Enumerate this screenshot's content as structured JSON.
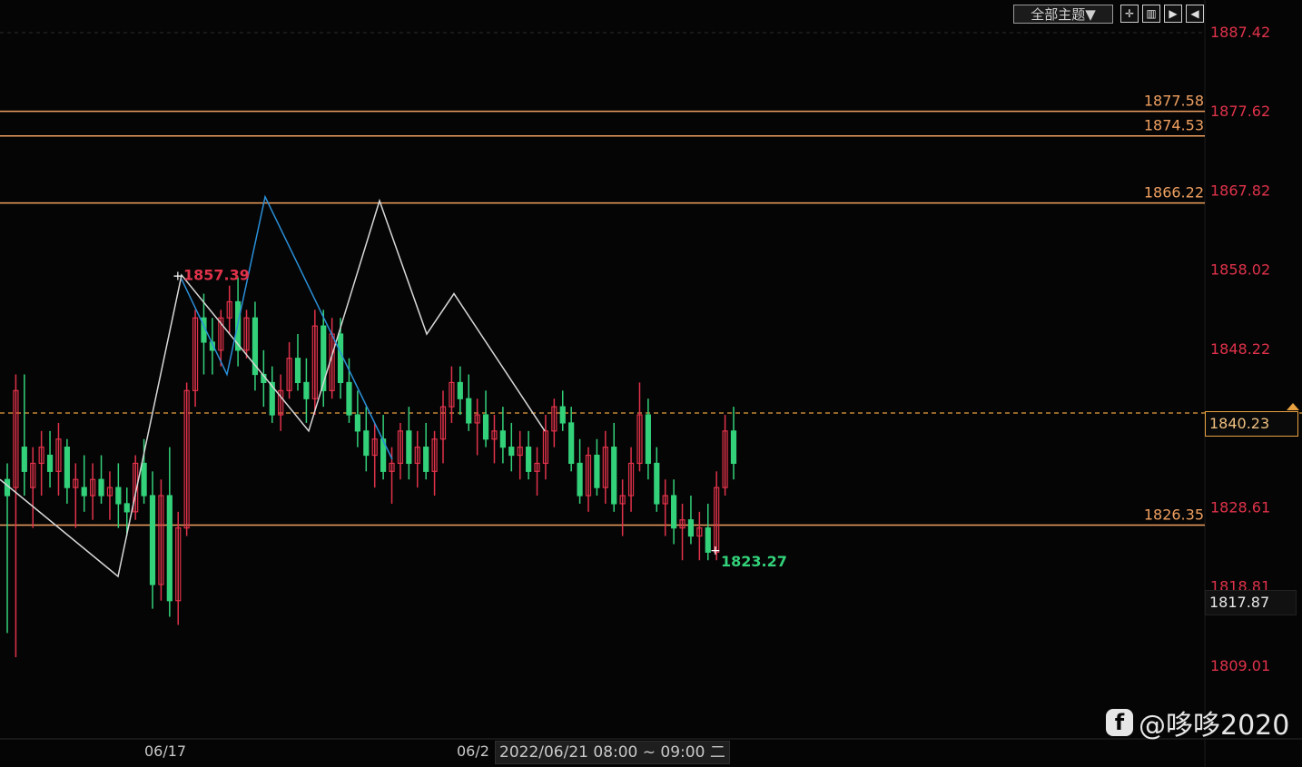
{
  "toolbar": {
    "theme_label": "全部主题▼",
    "icons": [
      "crosshair-icon",
      "bar-chart-icon",
      "play-icon",
      "back-icon"
    ]
  },
  "colors": {
    "background": "#050505",
    "up": "#e0324a",
    "down": "#33d17a",
    "level_line": "#f0a060",
    "current_line": "#e8a040",
    "zigzag_white": "#d8d8d8",
    "zigzag_blue": "#2a8fd8"
  },
  "chart_data": {
    "type": "candlestick",
    "y_axis_ticks": [
      "1887.42",
      "1877.62",
      "1867.82",
      "1858.02",
      "1848.22",
      "1828.61",
      "1818.81",
      "1809.01"
    ],
    "horizontal_levels": [
      "1877.58",
      "1874.53",
      "1866.22",
      "1826.35"
    ],
    "current_price": "1840.23",
    "hover_price": "1817.87",
    "annotations": {
      "high": "1857.39",
      "low": "1823.27"
    },
    "x_axis_dates": [
      "06/17",
      "06/2"
    ],
    "time_tooltip": "2022/06/21 08:00 ~ 09:00 二",
    "ylim": [
      1800,
      1890
    ],
    "candles": [
      [
        1832,
        1834,
        1813,
        1830
      ],
      [
        1831,
        1845,
        1810,
        1843
      ],
      [
        1836,
        1845,
        1830,
        1833
      ],
      [
        1831,
        1836,
        1826,
        1834
      ],
      [
        1834,
        1838,
        1830,
        1836
      ],
      [
        1835,
        1838,
        1831,
        1833
      ],
      [
        1833,
        1839,
        1830,
        1837
      ],
      [
        1836,
        1837,
        1829,
        1831
      ],
      [
        1831,
        1834,
        1826,
        1832
      ],
      [
        1831,
        1835,
        1828,
        1830
      ],
      [
        1830,
        1834,
        1827,
        1832
      ],
      [
        1832,
        1835,
        1829,
        1830
      ],
      [
        1830,
        1833,
        1827,
        1831
      ],
      [
        1831,
        1834,
        1826,
        1829
      ],
      [
        1829,
        1831,
        1825,
        1828
      ],
      [
        1828,
        1835,
        1827,
        1834
      ],
      [
        1834,
        1837,
        1829,
        1830
      ],
      [
        1830,
        1833,
        1816,
        1819
      ],
      [
        1819,
        1832,
        1817,
        1830
      ],
      [
        1830,
        1836,
        1815,
        1817
      ],
      [
        1817,
        1828,
        1814,
        1826
      ],
      [
        1826,
        1844,
        1825,
        1843
      ],
      [
        1843,
        1853,
        1841,
        1852
      ],
      [
        1852,
        1855,
        1845,
        1849
      ],
      [
        1849,
        1852,
        1845,
        1848
      ],
      [
        1848,
        1853,
        1846,
        1852
      ],
      [
        1852,
        1856,
        1850,
        1854
      ],
      [
        1854,
        1857,
        1846,
        1848
      ],
      [
        1848,
        1853,
        1847,
        1852
      ],
      [
        1852,
        1854,
        1843,
        1845
      ],
      [
        1845,
        1848,
        1841,
        1844
      ],
      [
        1844,
        1846,
        1839,
        1840
      ],
      [
        1840,
        1845,
        1838,
        1843
      ],
      [
        1843,
        1849,
        1842,
        1847
      ],
      [
        1847,
        1850,
        1843,
        1844
      ],
      [
        1844,
        1847,
        1839,
        1842
      ],
      [
        1842,
        1853,
        1840,
        1851
      ],
      [
        1851,
        1853,
        1841,
        1843
      ],
      [
        1843,
        1852,
        1842,
        1850
      ],
      [
        1850,
        1852,
        1842,
        1844
      ],
      [
        1844,
        1847,
        1839,
        1840
      ],
      [
        1840,
        1843,
        1836,
        1838
      ],
      [
        1838,
        1841,
        1833,
        1835
      ],
      [
        1835,
        1839,
        1831,
        1837
      ],
      [
        1837,
        1840,
        1832,
        1833
      ],
      [
        1833,
        1836,
        1829,
        1834
      ],
      [
        1834,
        1839,
        1832,
        1838
      ],
      [
        1838,
        1841,
        1832,
        1834
      ],
      [
        1834,
        1838,
        1831,
        1836
      ],
      [
        1836,
        1839,
        1832,
        1833
      ],
      [
        1833,
        1838,
        1830,
        1837
      ],
      [
        1837,
        1843,
        1834,
        1841
      ],
      [
        1841,
        1846,
        1839,
        1844
      ],
      [
        1844,
        1846,
        1840,
        1842
      ],
      [
        1842,
        1845,
        1838,
        1839
      ],
      [
        1839,
        1842,
        1835,
        1840
      ],
      [
        1840,
        1843,
        1836,
        1837
      ],
      [
        1837,
        1840,
        1834,
        1838
      ],
      [
        1838,
        1841,
        1834,
        1836
      ],
      [
        1836,
        1839,
        1833,
        1835
      ],
      [
        1835,
        1838,
        1832,
        1836
      ],
      [
        1836,
        1838,
        1832,
        1833
      ],
      [
        1833,
        1836,
        1830,
        1834
      ],
      [
        1834,
        1840,
        1832,
        1838
      ],
      [
        1838,
        1842,
        1836,
        1841
      ],
      [
        1841,
        1843,
        1838,
        1839
      ],
      [
        1839,
        1841,
        1833,
        1834
      ],
      [
        1834,
        1837,
        1829,
        1830
      ],
      [
        1830,
        1836,
        1828,
        1835
      ],
      [
        1835,
        1837,
        1830,
        1831
      ],
      [
        1831,
        1838,
        1829,
        1836
      ],
      [
        1836,
        1839,
        1828,
        1829
      ],
      [
        1829,
        1832,
        1825,
        1830
      ],
      [
        1830,
        1836,
        1828,
        1834
      ],
      [
        1834,
        1844,
        1833,
        1840
      ],
      [
        1840,
        1842,
        1832,
        1834
      ],
      [
        1834,
        1836,
        1828,
        1829
      ],
      [
        1829,
        1832,
        1825,
        1830
      ],
      [
        1830,
        1832,
        1824,
        1826
      ],
      [
        1826,
        1829,
        1822,
        1827
      ],
      [
        1827,
        1830,
        1824,
        1825
      ],
      [
        1825,
        1828,
        1822,
        1826
      ],
      [
        1826,
        1829,
        1822,
        1823
      ],
      [
        1823,
        1833,
        1822,
        1831
      ],
      [
        1831,
        1840,
        1830,
        1838
      ],
      [
        1838,
        1841,
        1832,
        1834
      ]
    ]
  },
  "watermark": {
    "logo": "f",
    "text": "@哆哆2020"
  }
}
